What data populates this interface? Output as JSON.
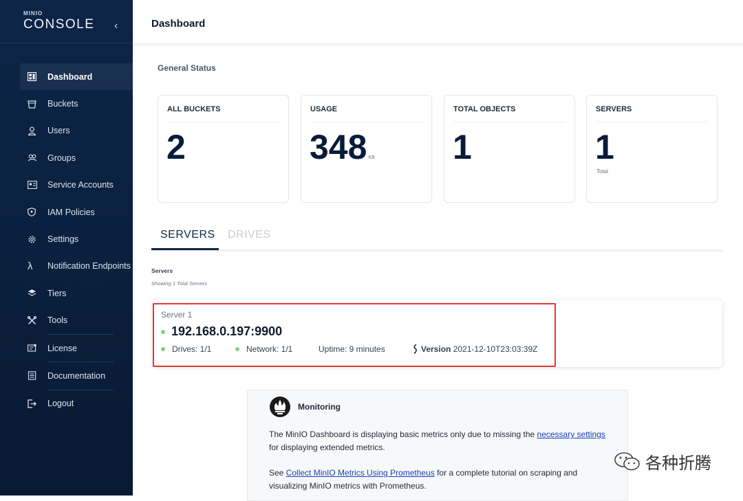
{
  "sidebar": {
    "brand_small": "MINIO",
    "brand_large": "CONSOLE",
    "items": [
      {
        "label": "Dashboard",
        "icon": "dashboard-icon"
      },
      {
        "label": "Buckets",
        "icon": "bucket-icon"
      },
      {
        "label": "Users",
        "icon": "user-icon"
      },
      {
        "label": "Groups",
        "icon": "groups-icon"
      },
      {
        "label": "Service Accounts",
        "icon": "service-accounts-icon"
      },
      {
        "label": "IAM Policies",
        "icon": "shield-icon"
      },
      {
        "label": "Settings",
        "icon": "gear-icon"
      },
      {
        "label": "Notification Endpoints",
        "icon": "lambda-icon"
      },
      {
        "label": "Tiers",
        "icon": "layers-icon"
      },
      {
        "label": "Tools",
        "icon": "tools-icon"
      },
      {
        "label": "License",
        "icon": "license-icon"
      },
      {
        "label": "Documentation",
        "icon": "documentation-icon"
      },
      {
        "label": "Logout",
        "icon": "logout-icon"
      }
    ]
  },
  "header": {
    "title": "Dashboard"
  },
  "general_status": {
    "title": "General Status",
    "cards": [
      {
        "title": "ALL BUCKETS",
        "value": "2",
        "unit": "",
        "sub": ""
      },
      {
        "title": "USAGE",
        "value": "348",
        "unit": "KB",
        "sub": ""
      },
      {
        "title": "TOTAL OBJECTS",
        "value": "1",
        "unit": "",
        "sub": ""
      },
      {
        "title": "SERVERS",
        "value": "1",
        "unit": "",
        "sub": "Total"
      }
    ]
  },
  "tabs": [
    {
      "label": "SERVERS",
      "active": true
    },
    {
      "label": "DRIVES",
      "active": false
    }
  ],
  "servers": {
    "heading": "Servers",
    "subheading": "Showing 1 Total Servers",
    "list": [
      {
        "name": "Server 1",
        "address": "192.168.0.197:9900",
        "drives": "Drives: 1/1",
        "network": "Network: 1/1",
        "uptime": "Uptime: 9 minutes",
        "version_label": "Version",
        "version_value": "2021-12-10T23:03:39Z",
        "status_color": "#7fd47a"
      }
    ]
  },
  "monitoring": {
    "title": "Monitoring",
    "p1_a": "The MinIO Dashboard is displaying basic metrics only due to missing the ",
    "p1_link": "necessary settings",
    "p1_b": " for displaying extended metrics.",
    "p2_a": "See ",
    "p2_link": "Collect MinIO Metrics Using Prometheus",
    "p2_b": " for a complete tutorial on scraping and visualizing MinIO metrics with Prometheus."
  },
  "watermark": {
    "text": "各种折腾"
  },
  "colors": {
    "sidebar_bg": "#0b2242",
    "accent": "#0f2540",
    "online": "#7fd47a",
    "highlight": "#e53935",
    "link": "#1a3fb8"
  }
}
